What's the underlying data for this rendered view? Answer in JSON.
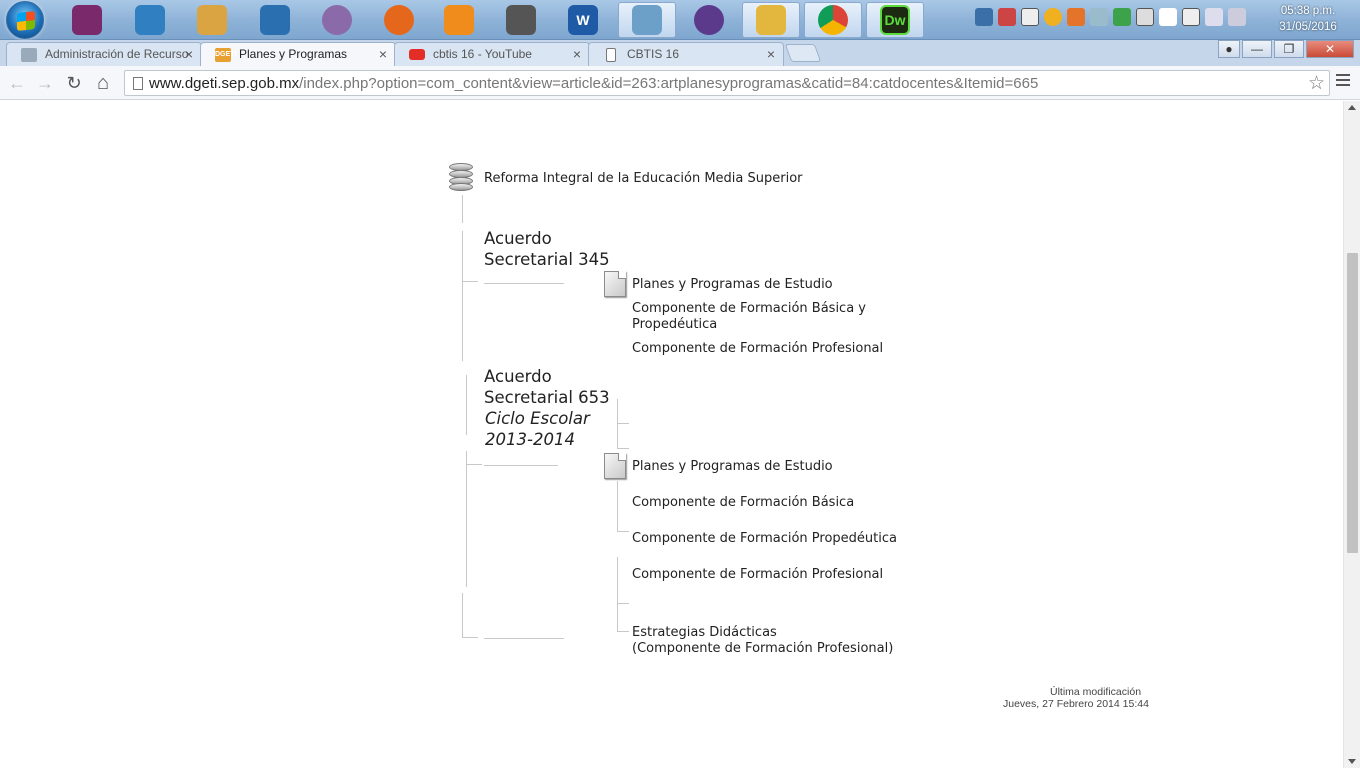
{
  "taskbar": {
    "apps": [
      {
        "icon": "winrar-icon",
        "color": "#7a2a6b"
      },
      {
        "icon": "control-panel-icon",
        "color": "#2f7fc1"
      },
      {
        "icon": "paint-icon",
        "color": "#d9a441"
      },
      {
        "icon": "scanner-icon",
        "color": "#2a6fb0"
      },
      {
        "icon": "dvd-icon",
        "color": "#8a6aa8"
      },
      {
        "icon": "firefox-icon",
        "color": "#e5671b"
      },
      {
        "icon": "media-player-icon",
        "color": "#f08c1c"
      },
      {
        "icon": "network-laptop-icon",
        "color": "#555555"
      },
      {
        "icon": "word-icon",
        "color": "#1f5aa6"
      },
      {
        "icon": "notepad-icon",
        "color": "#6ca0c8"
      },
      {
        "icon": "cat-app-icon",
        "color": "#5b3a8c"
      },
      {
        "icon": "file-explorer-icon",
        "color": "#e3b73e"
      },
      {
        "icon": "chrome-icon",
        "color": "#2da44a"
      },
      {
        "icon": "dreamweaver-icon",
        "color": "#35a02a"
      }
    ],
    "word_glyph": "W",
    "dw_glyph": "Dw",
    "clock_time": "05:38 p.m.",
    "clock_date": "31/05/2016"
  },
  "tabs": [
    {
      "title": "Administración de Recurso",
      "favicon": "sgeti-icon",
      "favicon_label": "",
      "active": false
    },
    {
      "title": "Planes y Programas",
      "favicon": "dgeti-icon",
      "favicon_label": "DGETI",
      "active": true
    },
    {
      "title": "cbtis 16 - YouTube",
      "favicon": "youtube-icon",
      "favicon_label": "",
      "active": false
    },
    {
      "title": "CBTIS 16",
      "favicon": "page-icon",
      "favicon_label": "",
      "active": false
    }
  ],
  "close_glyph": "×",
  "window_controls": {
    "minimize": "—",
    "restore": "❐",
    "close": "✕"
  },
  "toolbar": {
    "url_host": "www.dgeti.sep.gob.mx",
    "url_path": "/index.php?option=com_content&view=article&id=263:artplanesyprogramas&catid=84:catdocentes&Itemid=665",
    "back": "←",
    "forward": "→",
    "reload": "↻",
    "home": "⌂",
    "star": "☆"
  },
  "tree": {
    "root": "Reforma Integral de la Educación Media Superior",
    "acuerdo345": {
      "line1": "Acuerdo",
      "line2": "Secretarial 345",
      "plan": "Planes y Programas de Estudio",
      "comp1_line1": "Componente de Formación Básica y",
      "comp1_line2": "Propedéutica",
      "comp2": "Componente de Formación Profesional"
    },
    "acuerdo653": {
      "line1": "Acuerdo",
      "line2": "Secretarial 653",
      "line3": "Ciclo Escolar",
      "line4": "2013-2014",
      "plan": "Planes y Programas de Estudio",
      "comp1": "Componente de Formación Básica",
      "comp2": "Componente de Formación Propedéutica",
      "comp3": "Componente de Formación Profesional"
    },
    "estrategias_line1": "Estrategias Didácticas",
    "estrategias_line2": "(Componente de Formación Profesional)"
  },
  "footer": {
    "label": "Última modificación",
    "date": "Jueves, 27 Febrero 2014 15:44"
  }
}
